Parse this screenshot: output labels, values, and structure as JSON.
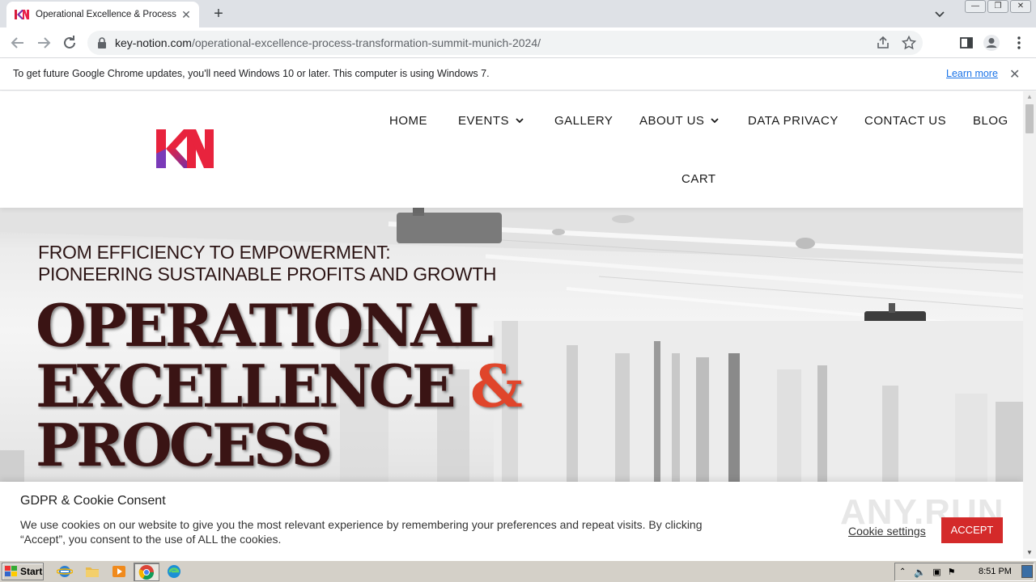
{
  "browser": {
    "tab_title": "Operational Excellence & Process Tra",
    "url_host": "key-notion.com",
    "url_path": "/operational-excellence-process-transformation-summit-munich-2024/",
    "infobar_text": "To get future Google Chrome updates, you'll need Windows 10 or later. This computer is using Windows 7.",
    "infobar_link": "Learn more"
  },
  "site": {
    "nav": {
      "home": "HOME",
      "events": "EVENTS",
      "gallery": "GALLERY",
      "about": "ABOUT US",
      "privacy": "DATA PRIVACY",
      "contact": "CONTACT US",
      "blog": "BLOG",
      "cart": "CART"
    },
    "hero": {
      "subtitle_line1": "FROM EFFICIENCY TO EMPOWERMENT:",
      "subtitle_line2": "PIONEERING SUSTAINABLE PROFITS AND GROWTH",
      "title_line1": "OPERATIONAL",
      "title_line2": "EXCELLENCE",
      "title_amp": "&",
      "title_line3": "PROCESS"
    }
  },
  "cookie": {
    "title": "GDPR & Cookie Consent",
    "text": "We use cookies on our website to give you the most relevant experience by remembering your preferences and repeat visits. By clicking “Accept”, you consent to the use of ALL the cookies.",
    "settings": "Cookie settings",
    "accept": "ACCEPT"
  },
  "watermark": "ANY.RUN",
  "taskbar": {
    "start": "Start",
    "clock": "8:51 PM"
  },
  "colors": {
    "accent_red": "#d42a2a",
    "hero_title": "#3a1414",
    "amp": "#e0452b",
    "link_blue": "#1a73e8"
  }
}
